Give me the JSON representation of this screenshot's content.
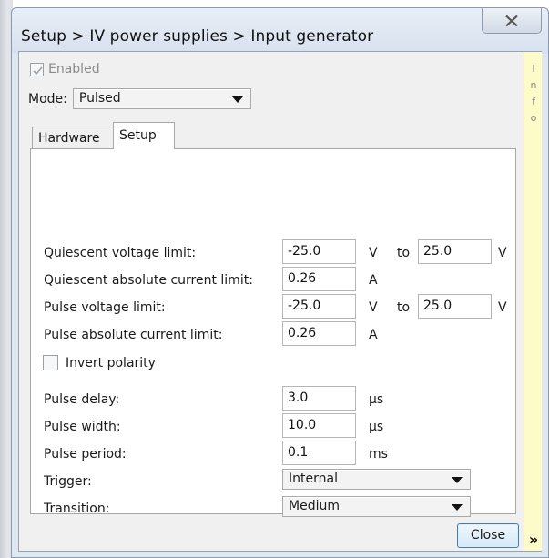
{
  "window": {
    "title": "Setup > IV power supplies > Input generator",
    "close_icon": "close-x-icon"
  },
  "enabled": {
    "label": "Enabled",
    "checked": true,
    "disabled": true
  },
  "mode": {
    "label": "Mode:",
    "value": "Pulsed"
  },
  "tabs": [
    {
      "label": "Hardware",
      "active": false
    },
    {
      "label": "Setup",
      "active": true
    }
  ],
  "setup": {
    "quiescent_voltage": {
      "label": "Quiescent voltage limit:",
      "min": "-25.0",
      "unit1": "V",
      "to": "to",
      "max": "25.0",
      "unit2": "V"
    },
    "quiescent_current": {
      "label": "Quiescent absolute current limit:",
      "value": "0.26",
      "unit": "A"
    },
    "pulse_voltage": {
      "label": "Pulse voltage limit:",
      "min": "-25.0",
      "unit1": "V",
      "to": "to",
      "max": "25.0",
      "unit2": "V"
    },
    "pulse_current": {
      "label": "Pulse absolute current limit:",
      "value": "0.26",
      "unit": "A"
    },
    "invert_polarity": {
      "label": "Invert polarity",
      "checked": false
    },
    "pulse_delay": {
      "label": "Pulse delay:",
      "value": "3.0",
      "unit": "µs"
    },
    "pulse_width": {
      "label": "Pulse width:",
      "value": "10.0",
      "unit": "µs"
    },
    "pulse_period": {
      "label": "Pulse period:",
      "value": "0.1",
      "unit": "ms"
    },
    "trigger": {
      "label": "Trigger:",
      "value": "Internal"
    },
    "transition": {
      "label": "Transition:",
      "value": "Medium"
    }
  },
  "info_panel": {
    "letters": [
      "I",
      "n",
      "f",
      "o"
    ],
    "expand_label": "»"
  },
  "buttons": {
    "close_label": "Close"
  },
  "colors": {
    "info_bg": "#fdfcc9",
    "title_bg": "#dfe7f1",
    "close_border": "#3c7fb1"
  }
}
